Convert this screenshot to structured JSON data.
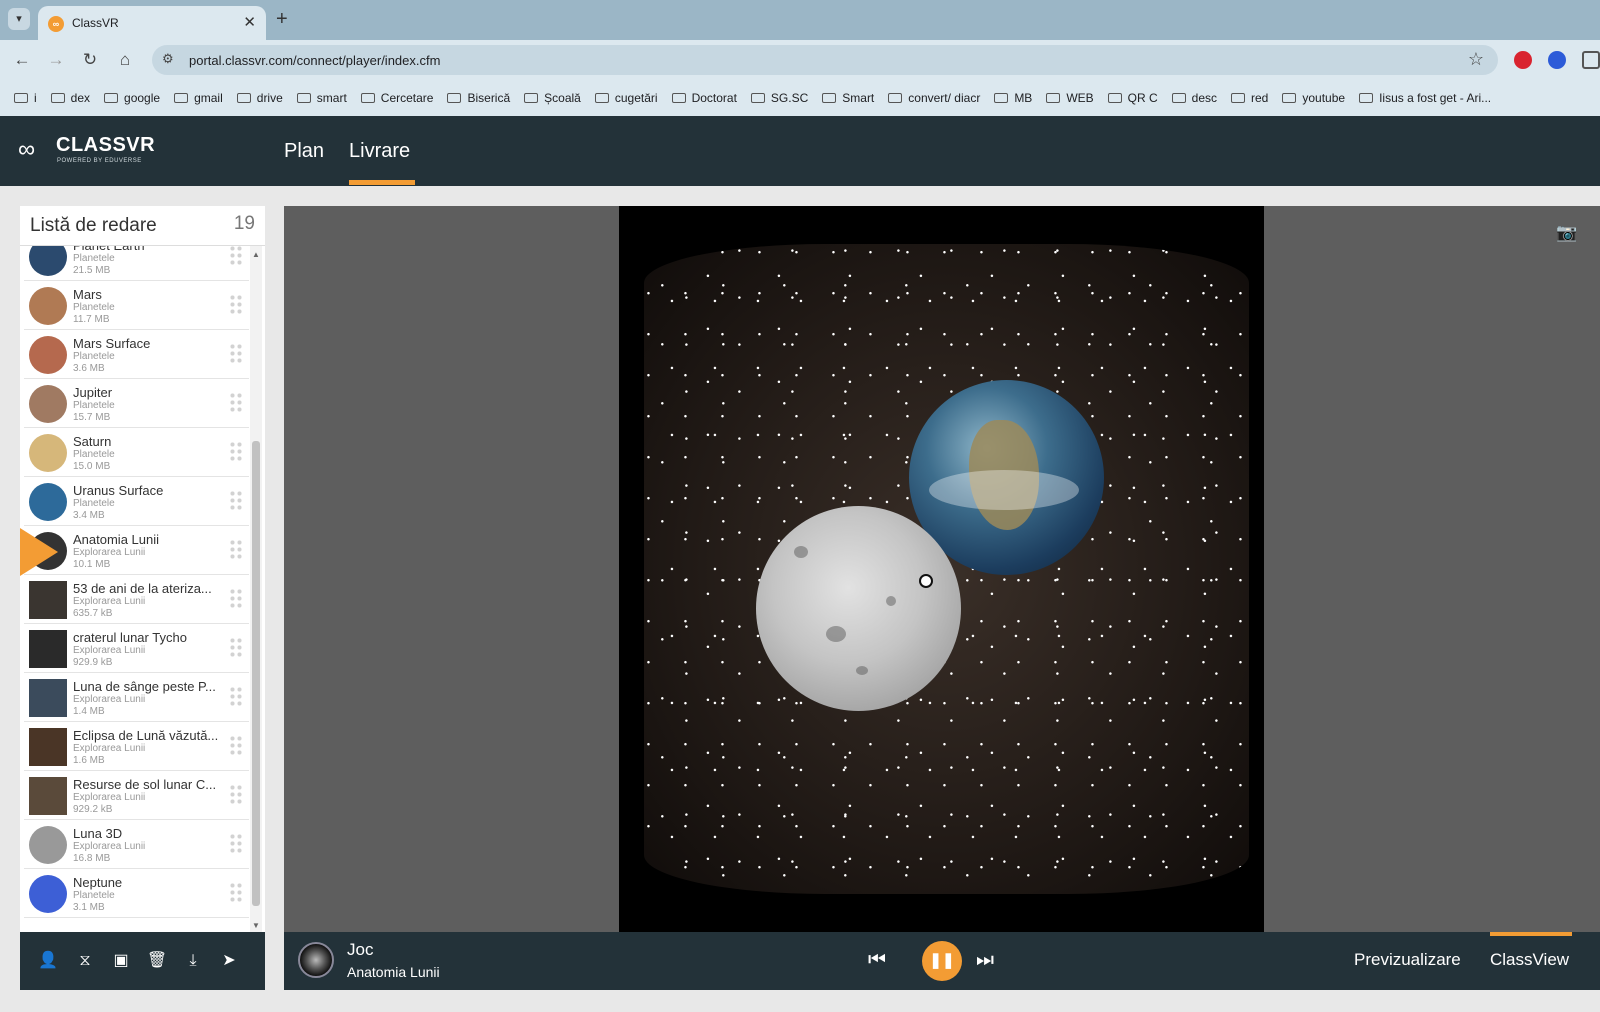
{
  "browser": {
    "tab_title": "ClassVR",
    "tab_favicon": "classvr-favicon",
    "url": "portal.classvr.com/connect/player/index.cfm",
    "bookmarks": [
      {
        "label": "i",
        "icon": "apple-icon"
      },
      {
        "label": "dex",
        "icon": "dex-icon"
      },
      {
        "label": "google",
        "icon": "google-icon"
      },
      {
        "label": "gmail",
        "icon": "gmail-icon"
      },
      {
        "label": "drive",
        "icon": "drive-icon"
      },
      {
        "label": "smart",
        "icon": "drive-icon"
      },
      {
        "label": "Cercetare",
        "icon": "folder-icon"
      },
      {
        "label": "Biserică",
        "icon": "folder-icon"
      },
      {
        "label": "Școală",
        "icon": "folder-icon"
      },
      {
        "label": "cugetări",
        "icon": "folder-icon"
      },
      {
        "label": "Doctorat",
        "icon": "folder-icon"
      },
      {
        "label": "SG.SC",
        "icon": "folder-icon"
      },
      {
        "label": "Smart",
        "icon": "folder-icon"
      },
      {
        "label": "convert/ diacr",
        "icon": "folder-icon"
      },
      {
        "label": "MB",
        "icon": "folder-icon"
      },
      {
        "label": "WEB",
        "icon": "folder-icon"
      },
      {
        "label": "QR C",
        "icon": "qr-icon"
      },
      {
        "label": "desc",
        "icon": "leaf-icon"
      },
      {
        "label": "red",
        "icon": "image-icon"
      },
      {
        "label": "youtube",
        "icon": "folder-icon"
      },
      {
        "label": "Iisus a fost get - Ari...",
        "icon": "page-icon"
      }
    ]
  },
  "app": {
    "logo_text": "CLASSVR",
    "logo_sub": "POWERED BY EDUVERSE",
    "nav": [
      {
        "label": "Plan",
        "active": false
      },
      {
        "label": "Livrare",
        "active": true
      }
    ],
    "accent_color": "#f39c34",
    "header_color": "#233239"
  },
  "playlist": {
    "title": "Listă de redare",
    "count": "19",
    "items": [
      {
        "title": "Planet Earth",
        "category": "Planetele",
        "size": "21.5 MB",
        "type_icon": "vr-icon",
        "thumb_color": "#2b4a6e",
        "round": true
      },
      {
        "title": "Mars",
        "category": "Planetele",
        "size": "11.7 MB",
        "type_icon": "vr-icon",
        "thumb_color": "#b07a54",
        "round": true
      },
      {
        "title": "Mars Surface",
        "category": "Planetele",
        "size": "3.6 MB",
        "type_icon": "image-icon",
        "thumb_color": "#b5694e",
        "round": true
      },
      {
        "title": "Jupiter",
        "category": "Planetele",
        "size": "15.7 MB",
        "type_icon": "vr-icon",
        "thumb_color": "#a07a62",
        "round": true
      },
      {
        "title": "Saturn",
        "category": "Planetele",
        "size": "15.0 MB",
        "type_icon": "vr-icon",
        "thumb_color": "#d6b77a",
        "round": true
      },
      {
        "title": "Uranus Surface",
        "category": "Planetele",
        "size": "3.4 MB",
        "type_icon": "image-icon",
        "thumb_color": "#2d6a9a",
        "round": true
      },
      {
        "title": "Anatomia Lunii",
        "category": "Explorarea Lunii",
        "size": "10.1 MB",
        "type_icon": "image-icon",
        "thumb_color": "#333333",
        "round": true
      },
      {
        "title": "53 de ani de la ateriza...",
        "category": "Explorarea Lunii",
        "size": "635.7 kB",
        "type_icon": "image-icon",
        "thumb_color": "#3a3530",
        "round": false
      },
      {
        "title": "craterul lunar Tycho",
        "category": "Explorarea Lunii",
        "size": "929.9 kB",
        "type_icon": "image-icon",
        "thumb_color": "#2a2a2a",
        "round": false
      },
      {
        "title": "Luna de sânge peste P...",
        "category": "Explorarea Lunii",
        "size": "1.4 MB",
        "type_icon": "image-icon",
        "thumb_color": "#3b4b5c",
        "round": false
      },
      {
        "title": "Eclipsa de Lună văzută...",
        "category": "Explorarea Lunii",
        "size": "1.6 MB",
        "type_icon": "image-icon",
        "thumb_color": "#4a3526",
        "round": false
      },
      {
        "title": "Resurse de sol lunar C...",
        "category": "Explorarea Lunii",
        "size": "929.2 kB",
        "type_icon": "image-icon",
        "thumb_color": "#5a4a3a",
        "round": false
      },
      {
        "title": "Luna 3D",
        "category": "Explorarea Lunii",
        "size": "16.8 MB",
        "type_icon": "vr-icon",
        "thumb_color": "#999999",
        "round": true
      },
      {
        "title": "Neptune",
        "category": "Planetele",
        "size": "3.1 MB",
        "type_icon": "vr-icon",
        "thumb_color": "#3d5fd6",
        "round": true
      }
    ],
    "playing_index": 6,
    "footer_icons": [
      "user-icon",
      "hourglass-icon",
      "save-icon",
      "trash-icon",
      "download-icon",
      "send-icon"
    ]
  },
  "player": {
    "status": "Joc",
    "current_title": "Anatomia Lunii",
    "preview_label": "Previzualizare",
    "classview_label": "ClassView"
  }
}
